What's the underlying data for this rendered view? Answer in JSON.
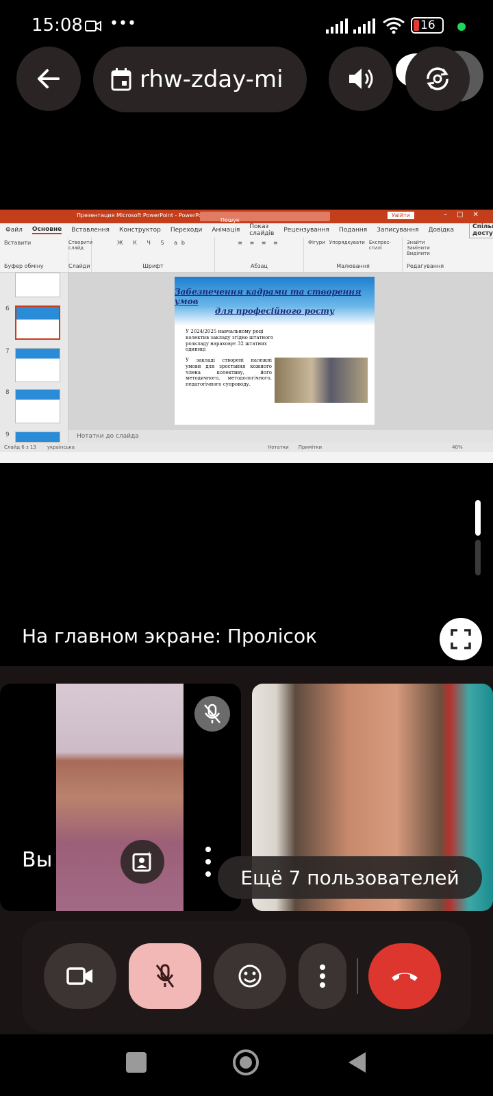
{
  "status_bar": {
    "time": "15:08",
    "battery": "16"
  },
  "top_bar": {
    "meeting_code": "rhw-zday-mi"
  },
  "shared_screen": {
    "app_title": "Презентация Microsoft PowerPoint  -  PowerPoint",
    "search_placeholder": "Пошук",
    "sign_in": "Увійти",
    "ribbon_tabs": [
      "Файл",
      "Основне",
      "Вставлення",
      "Конструктор",
      "Переходи",
      "Анімація",
      "Показ слайдів",
      "Рецензування",
      "Подання",
      "Записування",
      "Довідка"
    ],
    "share_button": "Спільний доступ",
    "ribbon_groups": [
      "Буфер обміну",
      "Слайди",
      "Шрифт",
      "Абзац",
      "Малювання",
      "Редагування"
    ],
    "ribbon_labels": {
      "paste": "Вставити",
      "new_slide": "Створити слайд",
      "shapes": "Фігури",
      "arrange": "Упорядкувати",
      "styles": "Експрес-стилі",
      "find": "Знайти",
      "replace": "Замінити",
      "select": "Виділити"
    },
    "thumb_numbers": [
      "6",
      "7",
      "8",
      "9"
    ],
    "slide": {
      "title_line1": "Забезпечення кадрами та створення умов",
      "title_line2": "для професійного росту",
      "paragraph1": "У 2024/2025 навчальному році колектив закладу згідно штатного розкладу нараховує 32 штатних одиниці",
      "paragraph2": "У закладі створені належні умови для зростання кожного члена колективу, його методичного, методологічного, педагогічного супроводу."
    },
    "notes": "Нотатки до слайда",
    "status_left": "Слайд 6 з 13",
    "status_lang": "українська",
    "status_notes": "Нотатки",
    "status_comments": "Примітки",
    "zoom": "40%"
  },
  "main_screen_label": "На главном экране: Пролісок",
  "self_tile": {
    "label": "Вы"
  },
  "others_pill": "Ещё 7 пользователей"
}
